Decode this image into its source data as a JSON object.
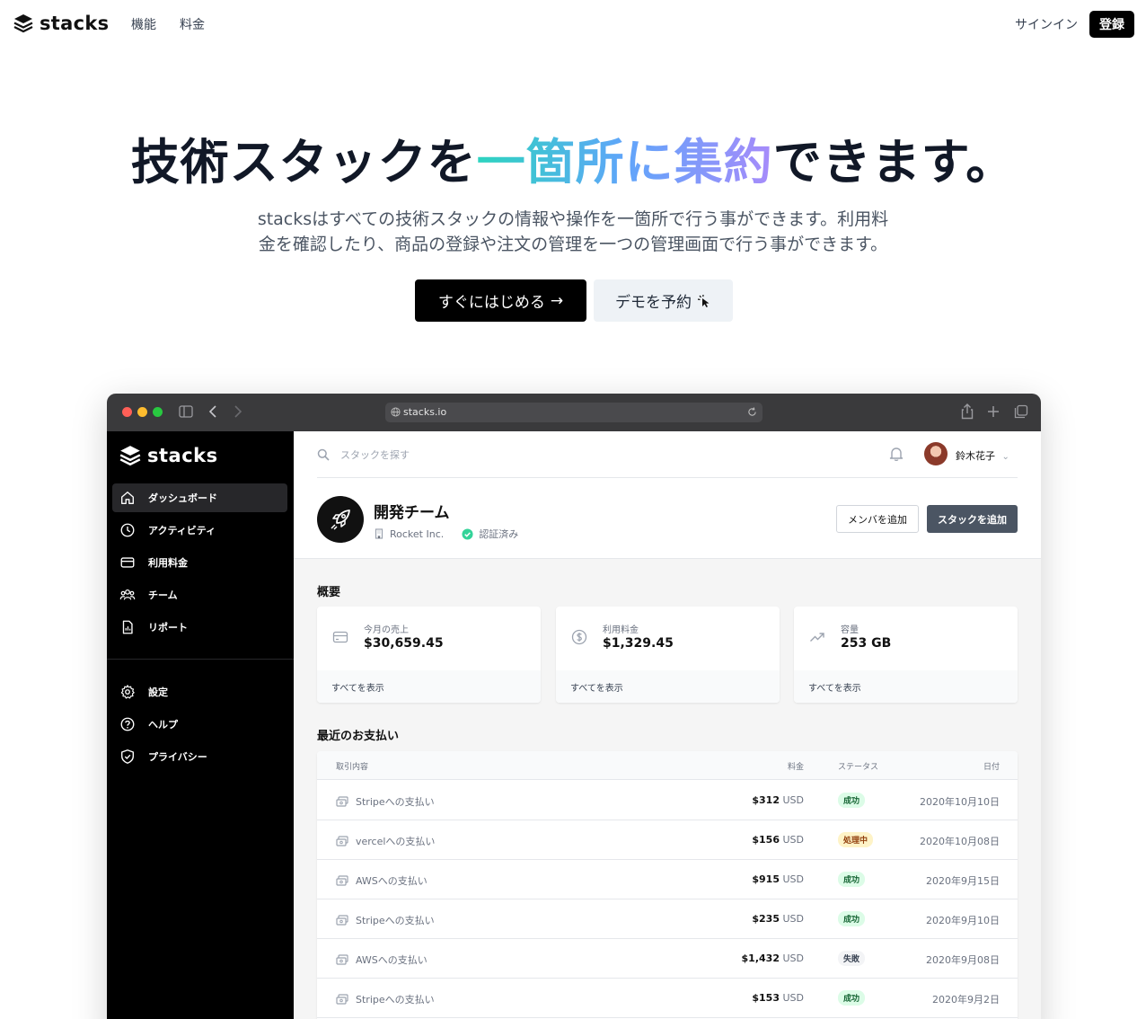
{
  "nav": {
    "brand": "stacks",
    "links": [
      "機能",
      "料金"
    ],
    "signin": "サインイン",
    "register": "登録"
  },
  "hero": {
    "title_before": "技術スタックを",
    "title_highlight": "一箇所に集約",
    "title_after": "できます。",
    "subtitle_line1": "stacksはすべての技術スタックの情報や操作を一箇所で行う事ができます。利用料",
    "subtitle_line2": "金を確認したり、商品の登録や注文の管理を一つの管理画面で行う事ができます。",
    "cta_primary": "すぐにはじめる",
    "cta_primary_arrow": "→",
    "cta_secondary": "デモを予約"
  },
  "browser": {
    "url": "stacks.io"
  },
  "app": {
    "brand": "stacks",
    "sidebar": [
      {
        "label": "ダッシュボード",
        "icon": "home-icon",
        "active": true
      },
      {
        "label": "アクティビティ",
        "icon": "clock-icon",
        "active": false
      },
      {
        "label": "利用料金",
        "icon": "credit-card-icon",
        "active": false
      },
      {
        "label": "チーム",
        "icon": "users-icon",
        "active": false
      },
      {
        "label": "リポート",
        "icon": "report-icon",
        "active": false
      }
    ],
    "sidebar_secondary": [
      {
        "label": "設定",
        "icon": "gear-icon"
      },
      {
        "label": "ヘルプ",
        "icon": "help-icon"
      },
      {
        "label": "プライバシー",
        "icon": "shield-icon"
      }
    ],
    "search_placeholder": "スタックを探す",
    "user_name": "鈴木花子",
    "team": {
      "name": "開発チーム",
      "company": "Rocket Inc.",
      "status": "認証済み"
    },
    "buttons": {
      "add_member": "メンバを追加",
      "add_stack": "スタックを追加"
    },
    "overview_title": "概要",
    "cards": [
      {
        "label": "今月の売上",
        "value": "$30,659.45",
        "footer": "すべてを表示",
        "icon": "card-icon"
      },
      {
        "label": "利用料金",
        "value": "$1,329.45",
        "footer": "すべてを表示",
        "icon": "dollar-icon"
      },
      {
        "label": "容量",
        "value": "253 GB",
        "footer": "すべてを表示",
        "icon": "trend-up-icon"
      }
    ],
    "payments_title": "最近のお支払い",
    "table_headers": {
      "desc": "取引内容",
      "amount": "料金",
      "status": "ステータス",
      "date": "日付"
    },
    "payments": [
      {
        "desc": "Stripeへの支払い",
        "amount": "$312",
        "currency": "USD",
        "status": "成功",
        "status_color": "#dcfce7",
        "status_text": "#166534",
        "date": "2020年10月10日"
      },
      {
        "desc": "vercelへの支払い",
        "amount": "$156",
        "currency": "USD",
        "status": "処理中",
        "status_color": "#fef3c7",
        "status_text": "#92400e",
        "date": "2020年10月08日"
      },
      {
        "desc": "AWSへの支払い",
        "amount": "$915",
        "currency": "USD",
        "status": "成功",
        "status_color": "#dcfce7",
        "status_text": "#166534",
        "date": "2020年9月15日"
      },
      {
        "desc": "Stripeへの支払い",
        "amount": "$235",
        "currency": "USD",
        "status": "成功",
        "status_color": "#dcfce7",
        "status_text": "#166534",
        "date": "2020年9月10日"
      },
      {
        "desc": "AWSへの支払い",
        "amount": "$1,432",
        "currency": "USD",
        "status": "失敗",
        "status_color": "#f3f4f6",
        "status_text": "#374151",
        "date": "2020年9月08日"
      },
      {
        "desc": "Stripeへの支払い",
        "amount": "$153",
        "currency": "USD",
        "status": "成功",
        "status_color": "#dcfce7",
        "status_text": "#166534",
        "date": "2020年9月2日"
      }
    ]
  }
}
